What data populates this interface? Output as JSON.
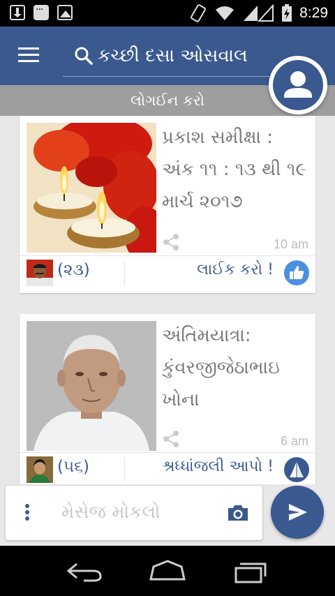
{
  "status_bar": {
    "time": "8:29",
    "icons_left": [
      "download-icon",
      "message-icon",
      "image-icon"
    ],
    "icons_right": [
      "vibrate-icon",
      "wifi-icon",
      "signal-icon",
      "battery-icon"
    ]
  },
  "app_bar": {
    "search_placeholder": "કચ્છી દસા ઓસવાલ",
    "bg_color": "#3a5a8f"
  },
  "login": {
    "label": "લોગઈન કરો"
  },
  "posts": [
    {
      "title": "પ્રકાશ સમીક્ષા : અંક ૧૧ : ૧૩ થી ૧૯ માર્ચ ૨૦૧૭",
      "time": "10 am",
      "count": "(૨૩)",
      "action": "લાઈક કરો !",
      "action_icon": "thumbs-up-icon",
      "thumb": "candles-photo"
    },
    {
      "title": "અંતિમયાત્રા: કુંવરજીજેઠાભાઇ ખોના",
      "time": "6 am",
      "count": "(૫૬)",
      "action": "શ્રધ્ધાંજલી આપો !",
      "action_icon": "praying-hands-icon",
      "thumb": "elderly-man-portrait"
    }
  ],
  "composer": {
    "placeholder": "મેસેજ મોકલો"
  },
  "colors": {
    "primary": "#3a5a8f",
    "login_bar": "#9e9e9e",
    "like_blue": "#4a90e2"
  }
}
